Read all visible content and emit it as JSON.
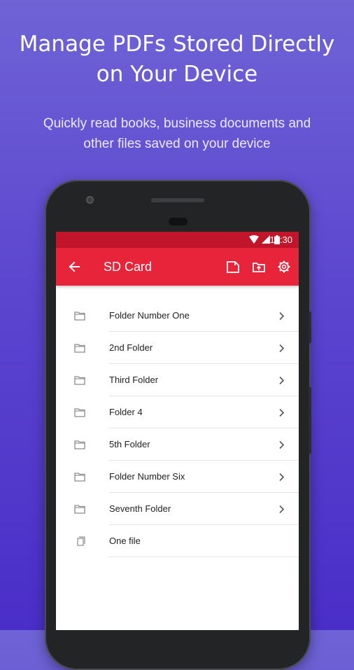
{
  "promo": {
    "headline_line1": "Manage PDFs Stored Directly",
    "headline_line2": "on Your Device",
    "subtitle_line1": "Quickly read books, business documents and",
    "subtitle_line2": "other files saved on your device"
  },
  "status_bar": {
    "time": "12:30",
    "icons": [
      "wifi-icon",
      "cell-signal-icon",
      "battery-icon"
    ]
  },
  "toolbar": {
    "title": "SD Card",
    "icons": [
      "back-arrow-icon",
      "sd-card-icon",
      "upload-icon",
      "gear-icon"
    ]
  },
  "items": [
    {
      "label": "Folder Number One",
      "type": "folder"
    },
    {
      "label": "2nd Folder",
      "type": "folder"
    },
    {
      "label": "Third Folder",
      "type": "folder"
    },
    {
      "label": "Folder 4",
      "type": "folder"
    },
    {
      "label": "5th Folder",
      "type": "folder"
    },
    {
      "label": "Folder Number Six",
      "type": "folder"
    },
    {
      "label": "Seventh Folder",
      "type": "folder"
    },
    {
      "label": "One file",
      "type": "file"
    }
  ],
  "colors": {
    "accent": "#e8243b",
    "status_bar": "#c0152a",
    "background_top": "#6f63d6",
    "background_bottom": "#4a2ec8"
  }
}
